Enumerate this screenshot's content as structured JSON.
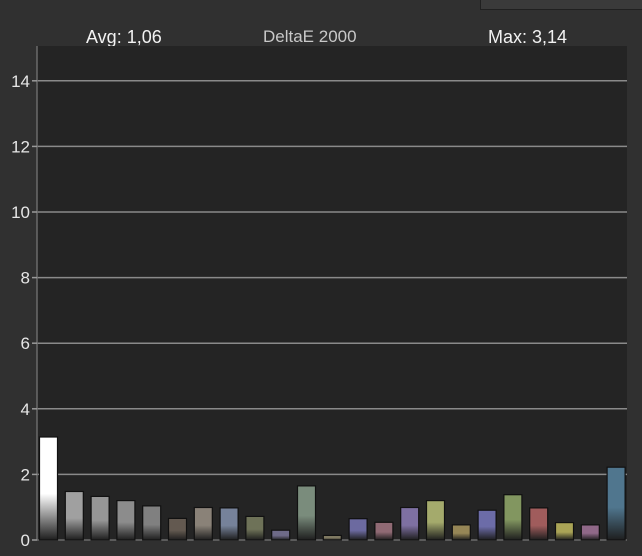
{
  "header": {
    "avg_text": "Avg: 1,06",
    "title": "DeltaE 2000",
    "max_text": "Max: 3,14"
  },
  "colors": {
    "background": "#303030",
    "plot_background": "#242424",
    "gridline": "#8a8a8a",
    "bar_outline": "#111111"
  },
  "chart_data": {
    "type": "bar",
    "title": "DeltaE 2000",
    "xlabel": "",
    "ylabel": "",
    "ylim": [
      0,
      15
    ],
    "yticks": [
      0,
      2,
      4,
      6,
      8,
      10,
      12,
      14
    ],
    "grid": true,
    "legend": "none",
    "summary": {
      "avg": "1,06",
      "max": "3,14"
    },
    "values": [
      3.14,
      1.48,
      1.33,
      1.2,
      1.04,
      0.66,
      0.99,
      0.98,
      0.72,
      0.3,
      1.65,
      0.14,
      0.65,
      0.54,
      0.99,
      1.2,
      0.46,
      0.91,
      1.38,
      0.98,
      0.53,
      0.46,
      2.22
    ],
    "bar_colors": [
      "#ffffff",
      "#a0a0a0",
      "#969696",
      "#8c8c8c",
      "#808080",
      "#635950",
      "#8a8278",
      "#76829a",
      "#6e7258",
      "#6e6a88",
      "#7a8c7c",
      "#807a62",
      "#6c6aa0",
      "#906a74",
      "#7e70a2",
      "#a4aa6c",
      "#968656",
      "#6c6ca8",
      "#829660",
      "#a05c5c",
      "#aaa456",
      "#906888",
      "#50768e"
    ]
  }
}
